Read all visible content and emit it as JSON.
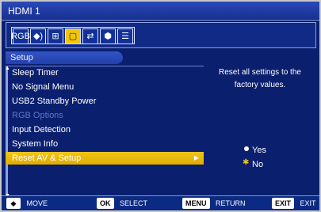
{
  "window": {
    "title": "HDMI 1"
  },
  "icon_tabs": [
    {
      "name": "rgb-icon",
      "glyph": "RGB"
    },
    {
      "name": "audio-icon",
      "glyph": "◆)"
    },
    {
      "name": "grid-icon",
      "glyph": "⊞"
    },
    {
      "name": "setup-icon",
      "glyph": "▢"
    },
    {
      "name": "input-icon",
      "glyph": "⇄"
    },
    {
      "name": "hexagon-icon",
      "glyph": "⬢"
    },
    {
      "name": "list-icon",
      "glyph": "☰"
    }
  ],
  "section_title": "Setup",
  "menu": {
    "items": [
      {
        "label": "Sleep Timer",
        "state": "normal"
      },
      {
        "label": "No Signal Menu",
        "state": "normal"
      },
      {
        "label": "USB2 Standby Power",
        "state": "normal"
      },
      {
        "label": "RGB Options",
        "state": "disabled"
      },
      {
        "label": "Input Detection",
        "state": "normal"
      },
      {
        "label": "System Info",
        "state": "normal"
      },
      {
        "label": "Reset AV & Setup",
        "state": "selected"
      }
    ]
  },
  "description": {
    "line1": "Reset all settings to the",
    "line2": "factory values."
  },
  "options": {
    "yes": "Yes",
    "no": "No"
  },
  "footer": {
    "move_label": "MOVE",
    "ok_key": "OK",
    "select_label": "SELECT",
    "menu_key": "MENU",
    "return_label": "RETURN",
    "exit_key": "EXIT",
    "exit_label": "EXIT"
  }
}
